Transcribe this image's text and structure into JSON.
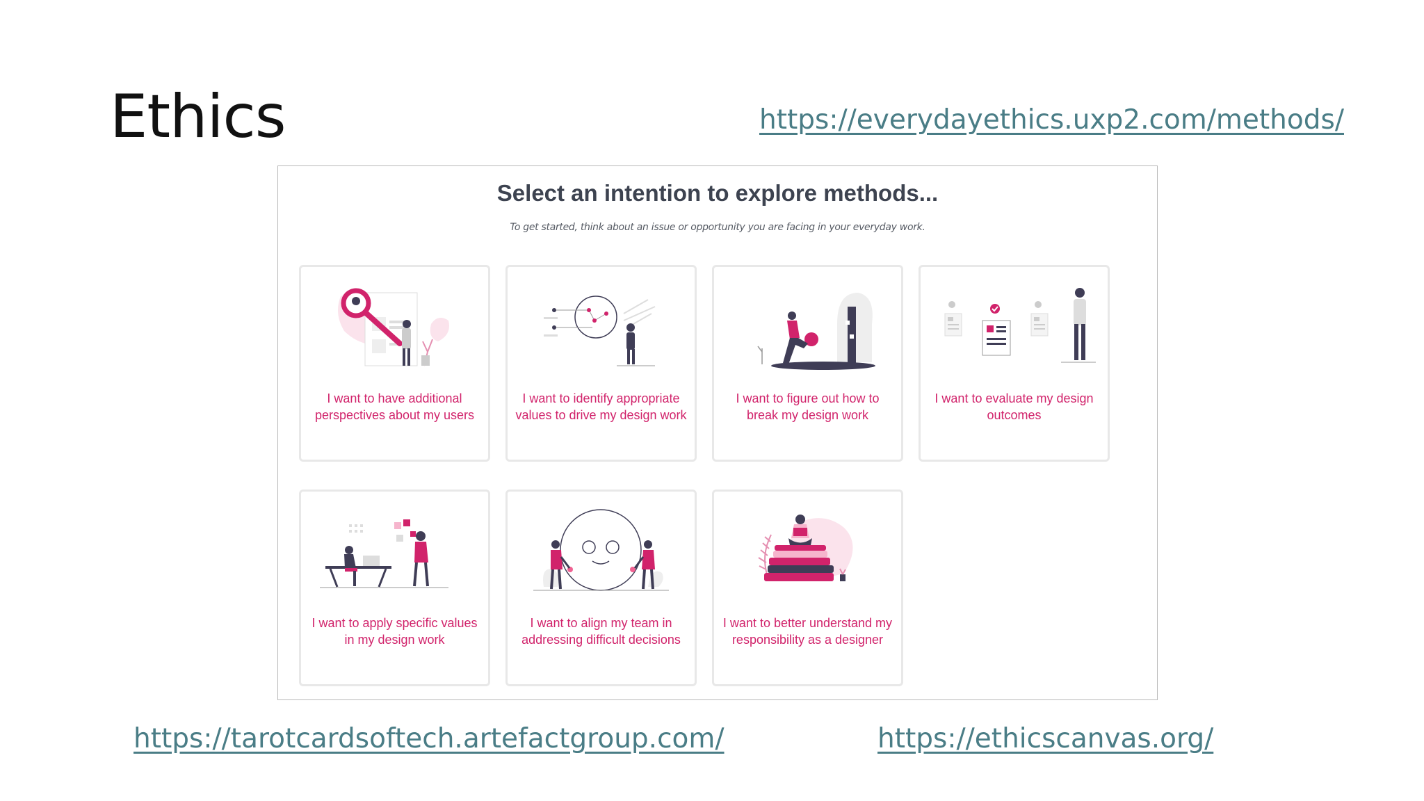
{
  "slide": {
    "title": "Ethics",
    "link_top": "https://everydayethics.uxp2.com/methods/",
    "link_bottom_left": "https://tarotcardsoftech.artefactgroup.com/",
    "link_bottom_right": "https://ethicscanvas.org/"
  },
  "screenshot": {
    "heading": "Select an intention to explore methods...",
    "subheading": "To get started, think about an issue or opportunity you are facing in your everyday work.",
    "cards": [
      {
        "label": "I want to have additional perspectives about my users",
        "icon": "magnifier-users-illustration"
      },
      {
        "label": "I want to identify appropriate values to drive my design work",
        "icon": "values-diagram-illustration"
      },
      {
        "label": "I want to figure out how to break my design work",
        "icon": "break-design-illustration"
      },
      {
        "label": "I want to evaluate my design outcomes",
        "icon": "evaluate-outcomes-illustration"
      },
      {
        "label": "I want to apply specific values in my design work",
        "icon": "apply-values-illustration"
      },
      {
        "label": "I want to align my team in addressing difficult decisions",
        "icon": "align-team-illustration"
      },
      {
        "label": "I want to better understand my responsibility as a designer",
        "icon": "responsibility-books-illustration"
      }
    ]
  },
  "colors": {
    "accent": "#d1236b",
    "link": "#4a7d86",
    "heading": "#3d4350",
    "card_border": "#e8e8e8"
  }
}
